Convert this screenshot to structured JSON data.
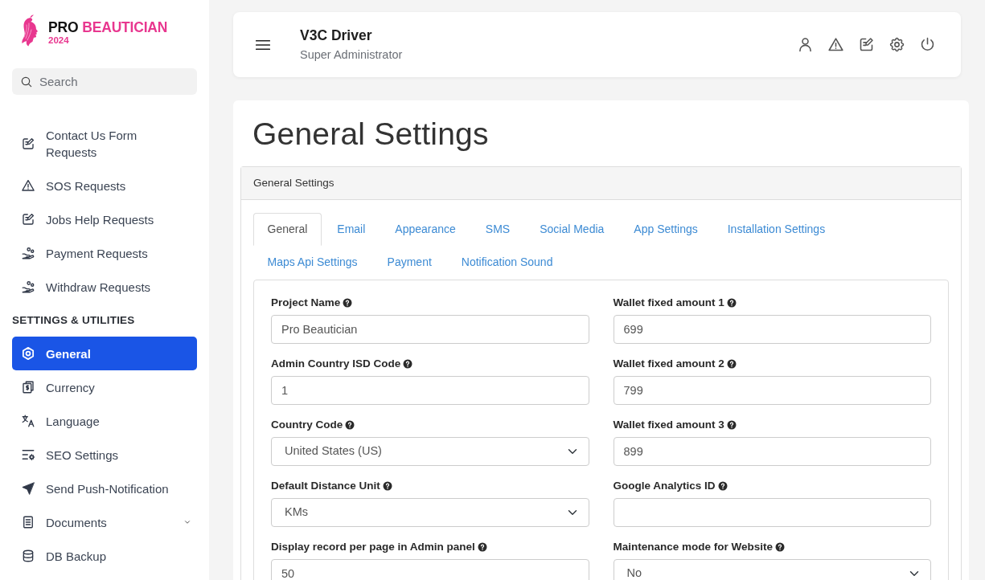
{
  "logo": {
    "brand_1": "PRO",
    "brand_2": "BEAUTICIAN",
    "year": "2024"
  },
  "sidebar": {
    "search": {
      "placeholder": "Search"
    },
    "sections": [
      {
        "items": [
          {
            "label": "Contact Us Form Requests",
            "selected": false,
            "expandable": false
          },
          {
            "label": "SOS Requests",
            "selected": false,
            "expandable": false
          },
          {
            "label": "Jobs Help Requests",
            "selected": false,
            "expandable": false
          },
          {
            "label": "Payment Requests",
            "selected": false,
            "expandable": false
          },
          {
            "label": "Withdraw Requests",
            "selected": false,
            "expandable": false
          }
        ]
      },
      {
        "title": "SETTINGS & UTILITIES",
        "items": [
          {
            "label": "General",
            "selected": true,
            "expandable": false
          },
          {
            "label": "Currency",
            "selected": false,
            "expandable": false
          },
          {
            "label": "Language",
            "selected": false,
            "expandable": false
          },
          {
            "label": "SEO Settings",
            "selected": false,
            "expandable": false
          },
          {
            "label": "Send Push-Notification",
            "selected": false,
            "expandable": false
          },
          {
            "label": "Documents",
            "selected": false,
            "expandable": true
          },
          {
            "label": "DB Backup",
            "selected": false,
            "expandable": false
          }
        ]
      }
    ]
  },
  "header": {
    "title": "V3C Driver",
    "subtitle": "Super Administrator"
  },
  "page": {
    "title": "General Settings",
    "panel": {
      "title": "General Settings",
      "tabs": [
        {
          "label": "General",
          "selected": true
        },
        {
          "label": "Email",
          "selected": false
        },
        {
          "label": "Appearance",
          "selected": false
        },
        {
          "label": "SMS",
          "selected": false
        },
        {
          "label": "Social Media",
          "selected": false
        },
        {
          "label": "App Settings",
          "selected": false
        },
        {
          "label": "Installation Settings",
          "selected": false
        },
        {
          "label": "Maps Api Settings",
          "selected": false
        },
        {
          "label": "Payment",
          "selected": false
        },
        {
          "label": "Notification Sound",
          "selected": false
        }
      ],
      "fields": [
        {
          "label": "Project Name",
          "kind": "text",
          "value": "Pro Beautician"
        },
        {
          "label": "Wallet fixed amount 1",
          "kind": "text",
          "value": "699"
        },
        {
          "label": "Admin Country ISD Code",
          "kind": "text",
          "value": "1"
        },
        {
          "label": "Wallet fixed amount 2",
          "kind": "text",
          "value": "799"
        },
        {
          "label": "Country Code",
          "kind": "select",
          "value": "United States (US)"
        },
        {
          "label": "Wallet fixed amount 3",
          "kind": "text",
          "value": "899"
        },
        {
          "label": "Default Distance Unit",
          "kind": "select",
          "value": "KMs"
        },
        {
          "label": "Google Analytics ID",
          "kind": "text"
        },
        {
          "label": "Display record per page in Admin panel",
          "kind": "text",
          "value": "50"
        },
        {
          "label": "Maintenance mode for Website",
          "kind": "select",
          "value": "No"
        }
      ]
    }
  }
}
